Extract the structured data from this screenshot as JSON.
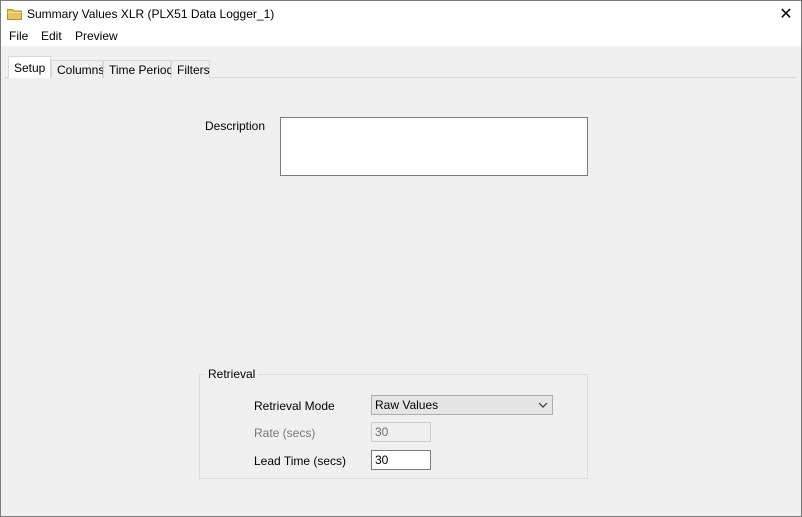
{
  "window": {
    "title": "Summary Values XLR (PLX51 Data Logger_1)",
    "close_glyph": "✕",
    "folder_color": "#e8c65a"
  },
  "menu": {
    "items": [
      "File",
      "Edit",
      "Preview"
    ]
  },
  "tabs": [
    {
      "label": "Setup",
      "active": true
    },
    {
      "label": "Columns",
      "active": false
    },
    {
      "label": "Time Period",
      "active": false
    },
    {
      "label": "Filters",
      "active": false
    }
  ],
  "setup": {
    "description_label": "Description",
    "description_value": "",
    "retrieval": {
      "group_title": "Retrieval",
      "mode_label": "Retrieval Mode",
      "mode_value": "Raw Values",
      "rate_label": "Rate (secs)",
      "rate_value": "30",
      "lead_label": "Lead Time (secs)",
      "lead_value": "30"
    }
  }
}
